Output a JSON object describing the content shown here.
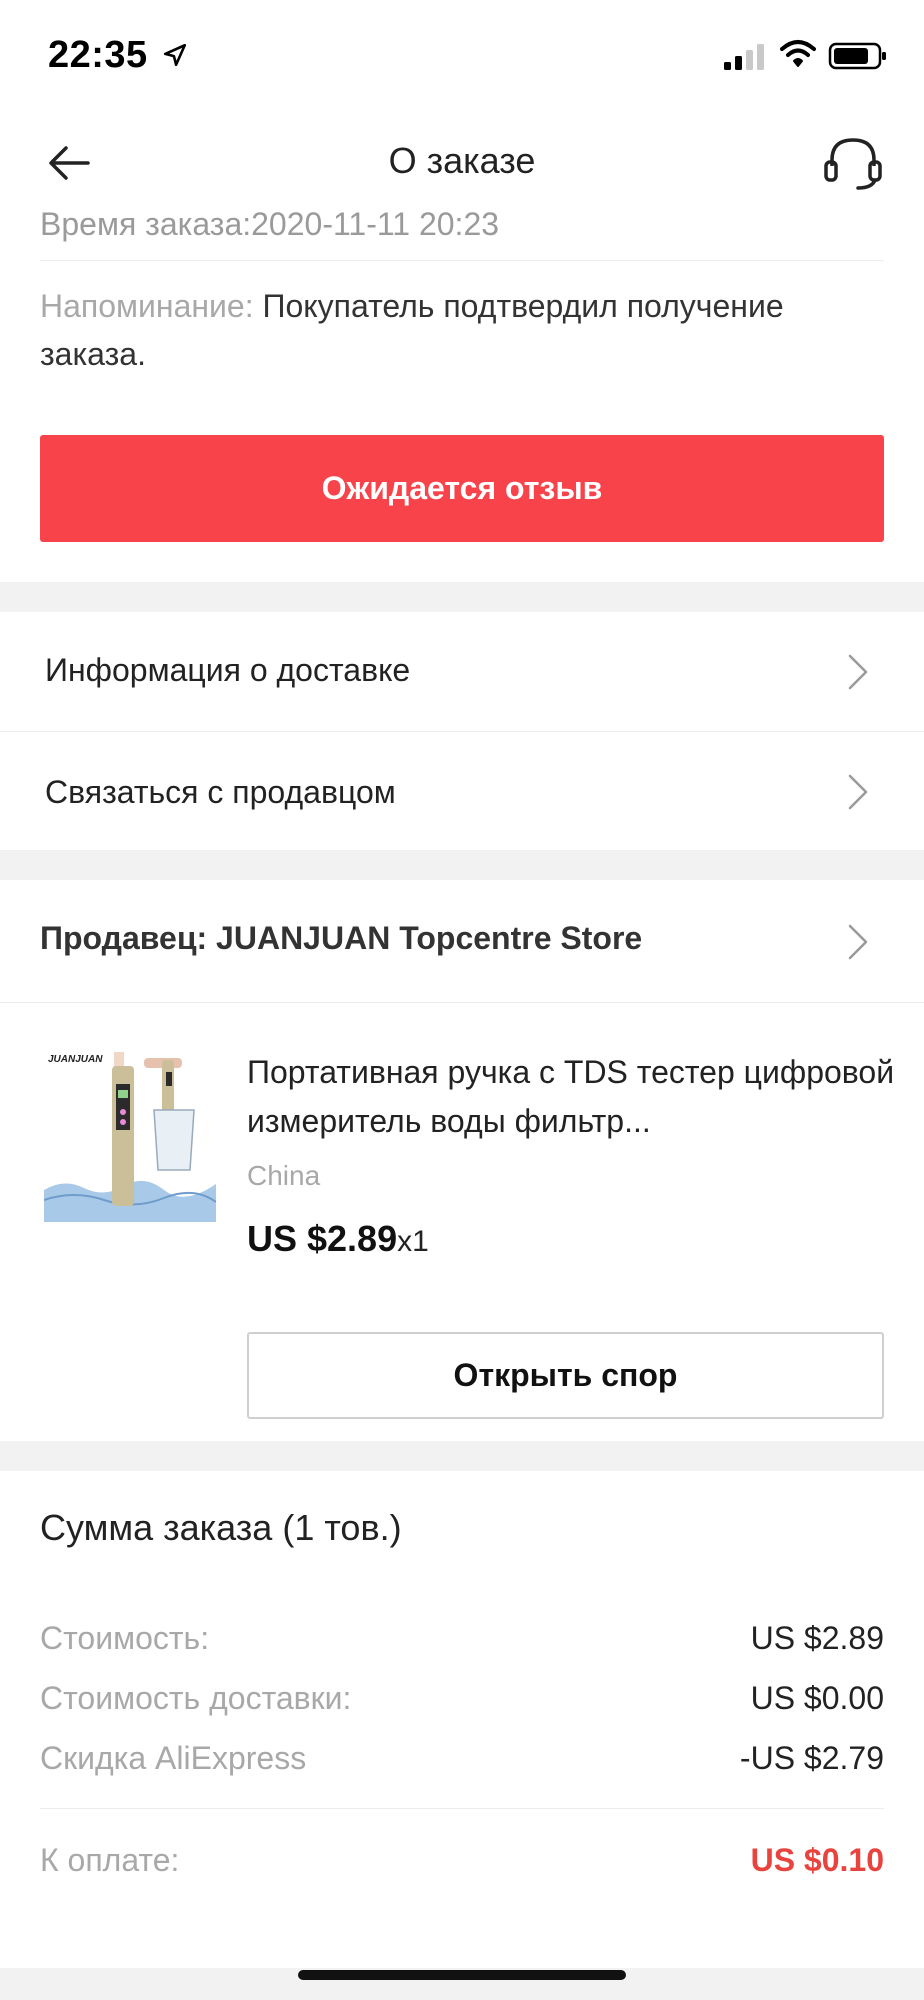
{
  "status_bar": {
    "time": "22:35",
    "icons": [
      "location-arrow-icon",
      "signal-icon",
      "wifi-icon",
      "battery-icon"
    ]
  },
  "nav": {
    "title": "О заказе",
    "back_icon": "back-arrow-icon",
    "support_icon": "headset-icon"
  },
  "order": {
    "time_text": "Время заказа:2020-11-11 20:23",
    "reminder_label": "Напоминание:",
    "reminder_text": "Покупатель подтвердил получение заказа.",
    "review_button": "Ожидается отзыв"
  },
  "menu": {
    "delivery_info": "Информация о доставке",
    "contact_seller": "Связаться с продавцом",
    "seller": "Продавец: JUANJUAN Topcentre Store"
  },
  "product": {
    "image_brand_text": "JUANJUAN",
    "title": "Портативная ручка с TDS тестер цифровой измеритель воды фильтр...",
    "origin": "China",
    "price": "US $2.89",
    "quantity": "x1",
    "dispute_button": "Открыть спор"
  },
  "summary": {
    "title": "Сумма заказа (1 тов.)",
    "cost_label": "Стоимость:",
    "cost_value": "US $2.89",
    "shipping_label": "Стоимость доставки:",
    "shipping_value": "US $0.00",
    "discount_label": "Скидка AliExpress",
    "discount_value": "-US $2.79",
    "total_label": "К оплате:",
    "total_value": "US $0.10"
  },
  "colors": {
    "accent_red": "#f8434a",
    "total_red": "#e8433d",
    "gap_gray": "#f2f2f2"
  }
}
